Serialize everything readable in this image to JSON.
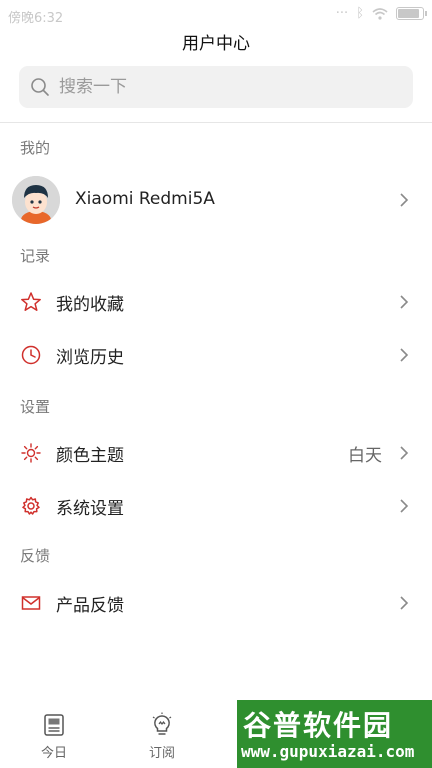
{
  "status_bar": {
    "time": "傍晚6:32"
  },
  "header": {
    "title": "用户中心"
  },
  "search": {
    "placeholder": "搜索一下"
  },
  "sections": {
    "mine": "我的",
    "records": "记录",
    "settings": "设置",
    "feedback": "反馈"
  },
  "profile": {
    "device_name": "Xiaomi Redmi5A"
  },
  "records": {
    "favorites": "我的收藏",
    "history": "浏览历史"
  },
  "settings": {
    "theme": "颜色主题",
    "theme_value": "白天",
    "system": "系统设置"
  },
  "feedback": {
    "product_feedback": "产品反馈"
  },
  "tabbar": {
    "today": "今日",
    "subscribe": "订阅"
  },
  "watermark": {
    "brand": "谷普软件园",
    "url": "www.gupuxiazai.com"
  },
  "colors": {
    "accent": "#d0302c",
    "watermark_bg": "#2f8f2f"
  }
}
